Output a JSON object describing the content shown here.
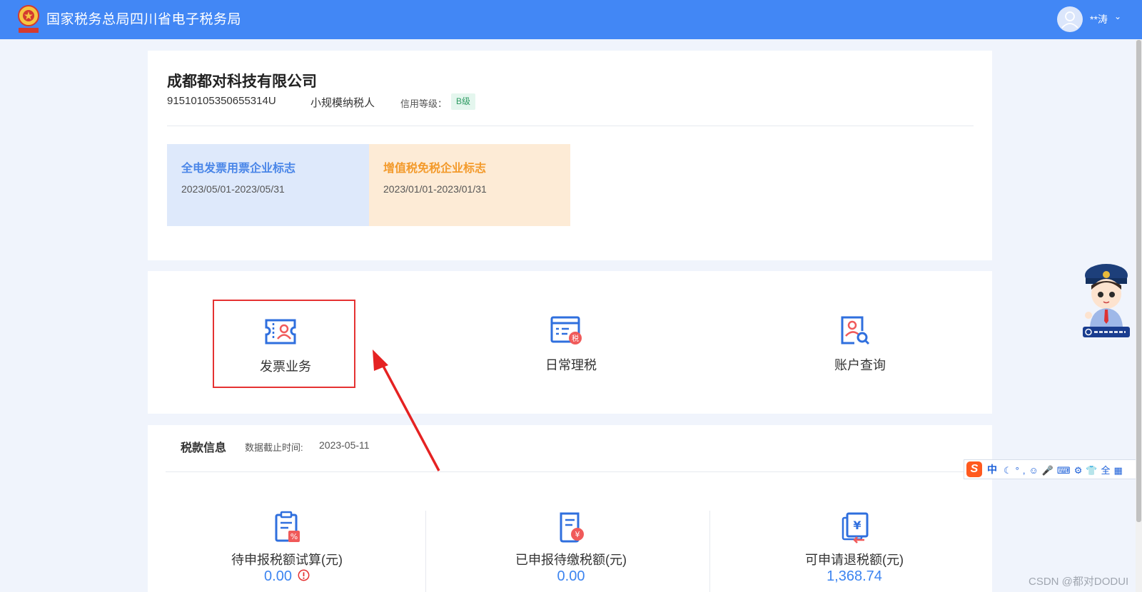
{
  "header": {
    "site_title": "国家税务总局四川省电子税务局",
    "user_name": "**涛",
    "user_caret": "⌄",
    "logo_icon": "tax-emblem-icon",
    "avatar_icon": "user-avatar-icon"
  },
  "company": {
    "name": "成都都对科技有限公司",
    "tax_id": "91510105350655314U",
    "taxpayer_type": "小规模纳税人",
    "credit_label": "信用等级：",
    "credit_grade": "B级"
  },
  "flags": [
    {
      "title": "全电发票用票企业标志",
      "period": "2023/05/01-2023/05/31"
    },
    {
      "title": "增值税免税企业标志",
      "period": "2023/01/01-2023/01/31"
    }
  ],
  "business": [
    {
      "label": "发票业务",
      "icon": "invoice-ticket-icon"
    },
    {
      "label": "日常理税",
      "icon": "tax-calendar-icon"
    },
    {
      "label": "账户查询",
      "icon": "account-search-icon"
    }
  ],
  "tax_info": {
    "title": "税款信息",
    "date_label": "数据截止时间:",
    "date_value": "2023-05-11",
    "stats": [
      {
        "label": "待申报税额试算(元)",
        "value": "0.00",
        "icon": "clipboard-percent-icon"
      },
      {
        "label": "已申报待缴税额(元)",
        "value": "0.00",
        "icon": "document-yuan-icon"
      },
      {
        "label": "可申请退税额(元)",
        "value": "1,368.74",
        "icon": "refund-yuan-icon"
      }
    ]
  },
  "ime": {
    "logo": "S",
    "mode": "中",
    "tools": "☾°,☺🎤⌨⚙👕全▦"
  },
  "watermark": "CSDN @都对DODUI",
  "colors": {
    "header_bg": "#4287f5",
    "accent_blue": "#3c84f0",
    "flag_blue_bg": "#dee9fb",
    "flag_orange_bg": "#fdebd6",
    "highlight_red": "#e53232"
  }
}
